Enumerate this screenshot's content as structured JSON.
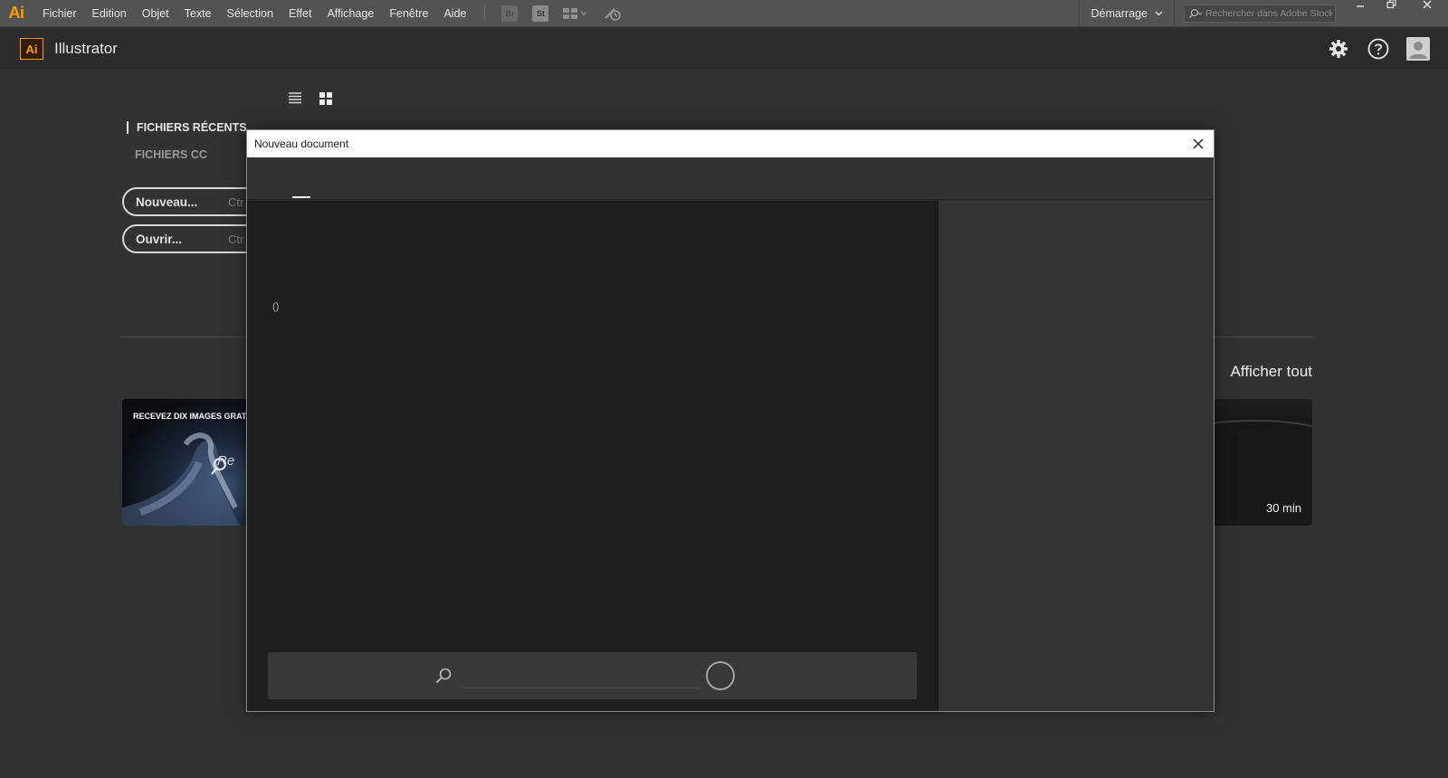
{
  "menubar": {
    "app_logo": "Ai",
    "items": [
      "Fichier",
      "Edition",
      "Objet",
      "Texte",
      "Sélection",
      "Effet",
      "Affichage",
      "Fenêtre",
      "Aide"
    ],
    "bridge_label": "Br",
    "stock_label": "St",
    "workspace_label": "Démarrage",
    "stock_search_placeholder": "Rechercher dans Adobe Stock",
    "window_buttons": [
      "minimize-icon",
      "restore-icon",
      "close-icon"
    ]
  },
  "header": {
    "logo": "Ai",
    "title": "Illustrator",
    "icons": [
      "gear-icon",
      "help-icon",
      "user-icon"
    ]
  },
  "start": {
    "nav": {
      "recent": "FICHIERS RÉCENTS",
      "cc": "FICHIERS CC"
    },
    "new_button": "Nouveau...",
    "new_shortcut": "Ctr",
    "open_button": "Ouvrir...",
    "open_shortcut": "Ctr",
    "show_all": "Afficher tout",
    "card_left_caption": "RECEVEZ DIX IMAGES GRATU",
    "card_left_overlay": "Re",
    "card_right_duration": "30 min"
  },
  "modal": {
    "title": "Nouveau document",
    "preset_placeholder_text": "()",
    "search_value": ""
  },
  "colors": {
    "accent": "#ff9a00",
    "menubar_bg": "#535353",
    "workspace_bg": "#323232",
    "modal_preset_bg": "#1e1e1e"
  }
}
